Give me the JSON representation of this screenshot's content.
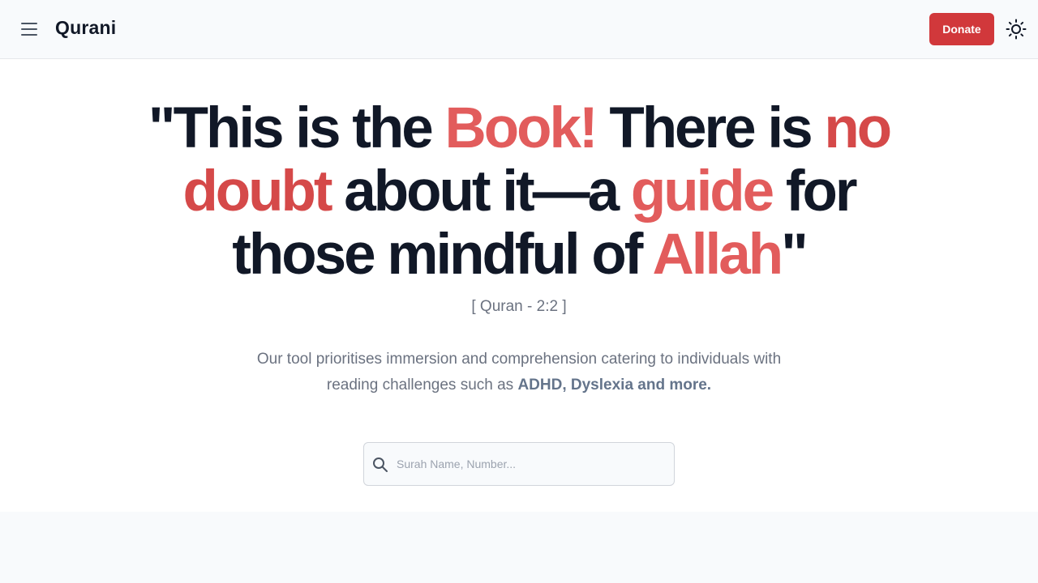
{
  "navbar": {
    "menu_icon": "hamburger-menu-icon",
    "brand": "Qurani",
    "donate_label": "Donate",
    "theme_icon": "sun-icon",
    "donate_color": "#d1383b"
  },
  "hero": {
    "quote": {
      "p1": "\"This is the ",
      "book": "Book!",
      "p2": " There is ",
      "nodoubt": "no doubt",
      "p3": " about it—a ",
      "guide": "guide",
      "p4": " for those mindful of ",
      "allah": "Allah",
      "p5": "\""
    },
    "reference": "[ Quran - 2:2 ]",
    "description": {
      "text": "Our tool prioritises immersion and comprehension catering to individuals with reading challenges such as ",
      "emphasis": "ADHD, Dyslexia and more."
    },
    "highlight_color": "#e25c5c"
  },
  "search": {
    "icon": "search-icon",
    "placeholder": "Surah Name, Number...",
    "value": ""
  }
}
